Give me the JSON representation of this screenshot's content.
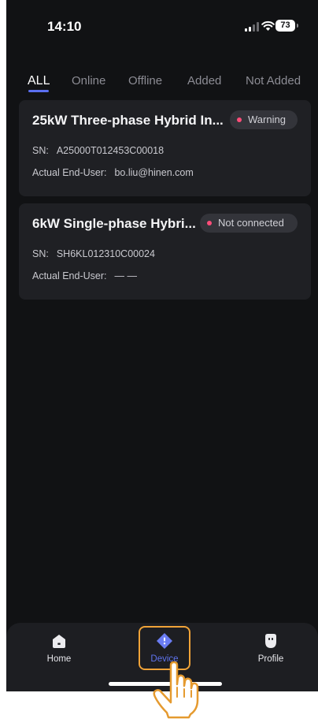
{
  "status_bar": {
    "time": "14:10",
    "battery": "73"
  },
  "tabs": [
    {
      "label": "ALL",
      "active": true
    },
    {
      "label": "Online",
      "active": false
    },
    {
      "label": "Offline",
      "active": false
    },
    {
      "label": "Added",
      "active": false
    },
    {
      "label": "Not Added",
      "active": false
    }
  ],
  "devices": [
    {
      "name": "25kW Three-phase Hybrid In...",
      "status": "Warning",
      "sn_label": "SN:",
      "sn": "A25000T012453C00018",
      "user_label": "Actual End-User:",
      "user": "bo.liu@hinen.com"
    },
    {
      "name": "6kW Single-phase Hybri...",
      "status": "Not connected",
      "sn_label": "SN:",
      "sn": "SH6KL012310C00024",
      "user_label": "Actual End-User:",
      "user": "— —"
    }
  ],
  "bottom_nav": {
    "items": [
      {
        "label": "Home",
        "icon": "home-icon",
        "active": false
      },
      {
        "label": "Device",
        "icon": "device-icon",
        "active": true
      },
      {
        "label": "Profile",
        "icon": "profile-icon",
        "active": false
      }
    ]
  },
  "colors": {
    "background": "#111214",
    "card": "#1f2024",
    "accent": "#5b6ff0",
    "status_dot": "#ff4d79",
    "highlight": "#f0a338"
  }
}
